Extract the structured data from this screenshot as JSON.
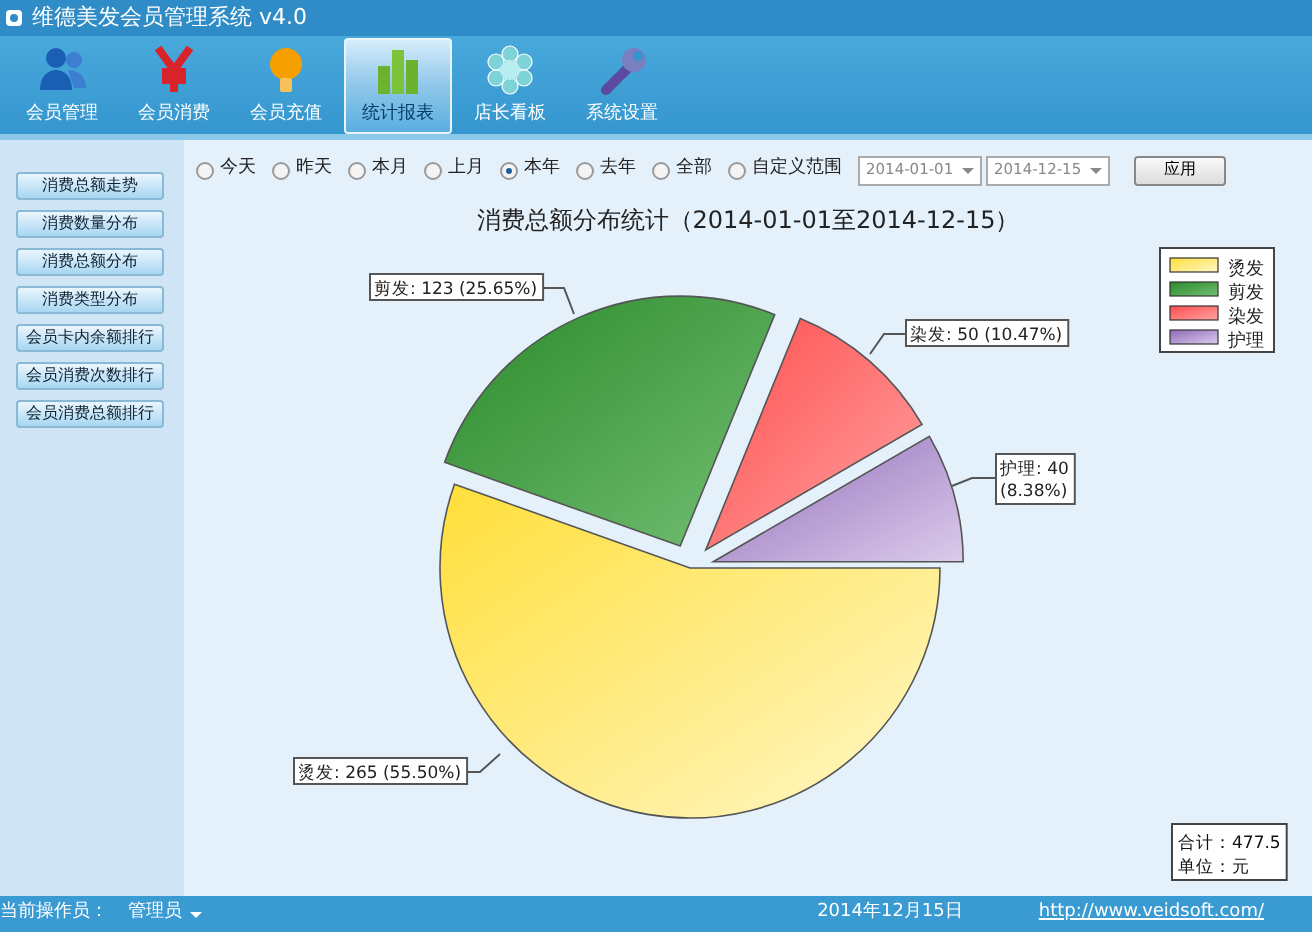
{
  "window": {
    "title": "维德美发会员管理系统 v4.0"
  },
  "toolbar": [
    {
      "label": "会员管理",
      "selected": false
    },
    {
      "label": "会员消费",
      "selected": false
    },
    {
      "label": "会员充值",
      "selected": false
    },
    {
      "label": "统计报表",
      "selected": true
    },
    {
      "label": "店长看板",
      "selected": false
    },
    {
      "label": "系统设置",
      "selected": false
    }
  ],
  "sidebar": {
    "items": [
      "消费总额走势",
      "消费数量分布",
      "消费总额分布",
      "消费类型分布",
      "会员卡内余额排行",
      "会员消费次数排行",
      "会员消费总额排行"
    ]
  },
  "period": [
    {
      "label": "今天",
      "selected": false
    },
    {
      "label": "昨天",
      "selected": false
    },
    {
      "label": "本月",
      "selected": false
    },
    {
      "label": "上月",
      "selected": false
    },
    {
      "label": "本年",
      "selected": true
    },
    {
      "label": "去年",
      "selected": false
    },
    {
      "label": "全部",
      "selected": false
    },
    {
      "label": "自定义范围",
      "selected": false
    }
  ],
  "date_from": {
    "value": "2014-01-01"
  },
  "date_to": {
    "value": "2014-12-15"
  },
  "apply_button": "应用",
  "chart": {
    "chart_data": {
      "type": "pie",
      "title": "消费总额分布统计（2014-01-01至2014-12-15）",
      "categories": [
        "烫发",
        "剪发",
        "染发",
        "护理"
      ],
      "legend": true,
      "values": [
        265,
        123,
        50,
        40
      ],
      "value_labels": [
        "烫发: 265 (55.50%)",
        "剪发: 123 (25.65%)",
        "染发: 50 (10.47%)",
        "护理: 40 (8.38%)"
      ]
    },
    "total": "合计：477.5",
    "unit": "单位：元"
  },
  "status_bar": {
    "operator_label": "当前操作员：",
    "operator": "管理员",
    "date": "2014年12月15日",
    "link": "http://www.veidsoft.com/"
  }
}
